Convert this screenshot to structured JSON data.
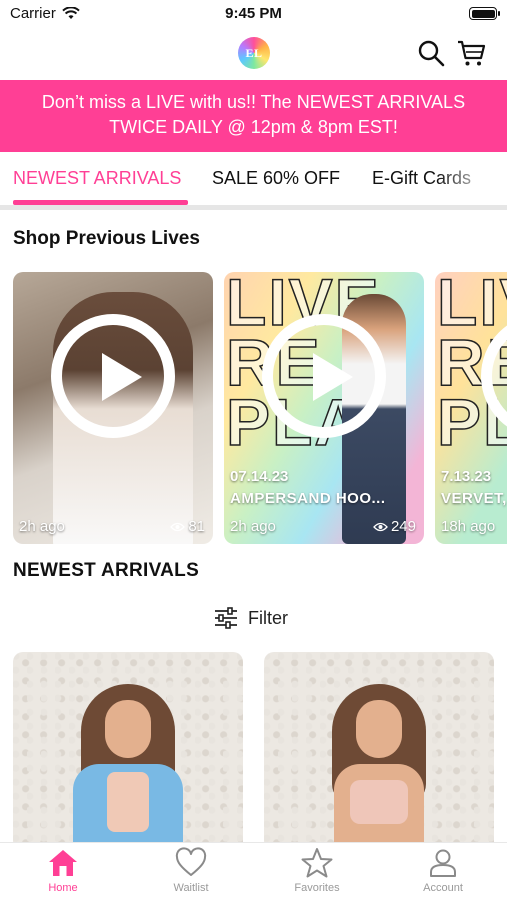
{
  "status_bar": {
    "carrier": "Carrier",
    "time": "9:45 PM"
  },
  "header": {
    "logo_text": "EL",
    "icons": [
      "search-icon",
      "cart-icon"
    ]
  },
  "banner": {
    "line1": "Don’t miss a LIVE with us!! The NEWEST ARRIVALS",
    "line2": "TWICE DAILY @ 12pm & 8pm EST!"
  },
  "tabs": [
    {
      "label": "NEWEST ARRIVALS",
      "active": true
    },
    {
      "label": "SALE 60% OFF",
      "active": false
    },
    {
      "label": "E-Gift Cards",
      "active": false
    }
  ],
  "colors": {
    "accent": "#ff3f95",
    "inactive": "#9a9a9a"
  },
  "sections": {
    "previous_lives": "Shop Previous Lives",
    "newest_arrivals": "NEWEST ARRIVALS"
  },
  "lives": [
    {
      "date": "",
      "title": "",
      "time_ago": "2h ago",
      "views": "81"
    },
    {
      "date": "07.14.23",
      "title": "AMPERSAND HOO...",
      "time_ago": "2h ago",
      "views": "249"
    },
    {
      "date": "7.13.23",
      "title": "VERVET,",
      "time_ago": "18h ago",
      "views": ""
    }
  ],
  "live_bg_text": "LIVE RE PLAY",
  "filter": {
    "label": "Filter"
  },
  "bottom_nav": [
    {
      "label": "Home",
      "icon": "home-icon",
      "active": true
    },
    {
      "label": "Waitlist",
      "icon": "heart-icon",
      "active": false
    },
    {
      "label": "Favorites",
      "icon": "star-icon",
      "active": false
    },
    {
      "label": "Account",
      "icon": "person-icon",
      "active": false
    }
  ]
}
